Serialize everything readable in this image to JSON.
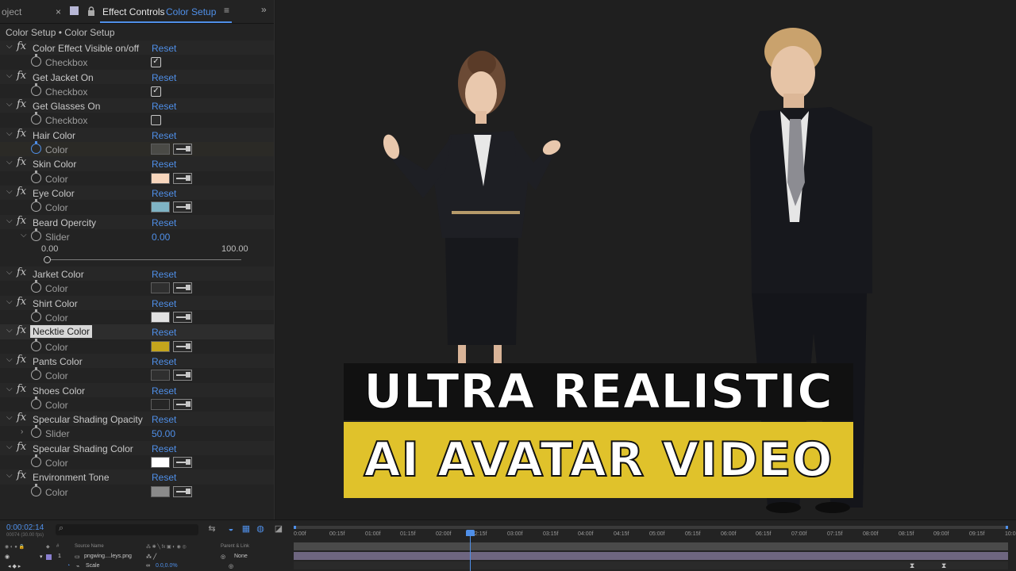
{
  "tabs": {
    "project_label": "oject",
    "close_glyph": "×",
    "lock_glyph": "🔒",
    "effect_controls_label": "Effect Controls",
    "comp_name": "Color Setup",
    "menu_glyph": "≡",
    "more_glyph": "»"
  },
  "breadcrumb": "Color Setup • Color Setup",
  "effects": [
    {
      "name": "Color Effect Visible on/off",
      "reset": "Reset",
      "param": "Checkbox",
      "kind": "checkbox",
      "checked": true
    },
    {
      "name": "Get Jacket On",
      "reset": "Reset",
      "param": "Checkbox",
      "kind": "checkbox",
      "checked": true
    },
    {
      "name": "Get Glasses On",
      "reset": "Reset",
      "param": "Checkbox",
      "kind": "checkbox",
      "checked": false
    },
    {
      "name": "Hair Color",
      "reset": "Reset",
      "param": "Color",
      "kind": "color",
      "color": "#4a4a46"
    },
    {
      "name": "Skin Color",
      "reset": "Reset",
      "param": "Color",
      "kind": "color",
      "color": "#f7d6bd"
    },
    {
      "name": "Eye Color",
      "reset": "Reset",
      "param": "Color",
      "kind": "color",
      "color": "#7fb3c4"
    },
    {
      "name": "Beard Opercity",
      "reset": "Reset",
      "param": "Slider",
      "kind": "slider",
      "value": "0.00",
      "min": "0.00",
      "max": "100.00"
    },
    {
      "name": "Jarket Color",
      "reset": "Reset",
      "param": "Color",
      "kind": "color",
      "color": "#2f2f2f"
    },
    {
      "name": "Shirt Color",
      "reset": "Reset",
      "param": "Color",
      "kind": "color",
      "color": "#e2e2e2"
    },
    {
      "name": "Necktie Color",
      "reset": "Reset",
      "param": "Color",
      "kind": "color",
      "color": "#c5a51d"
    },
    {
      "name": "Pants Color",
      "reset": "Reset",
      "param": "Color",
      "kind": "color",
      "color": "#2f2f2f"
    },
    {
      "name": "Shoes Color",
      "reset": "Reset",
      "param": "Color",
      "kind": "color",
      "color": "#262626"
    },
    {
      "name": "Specular Shading Opacity",
      "reset": "Reset",
      "param": "Slider",
      "kind": "value",
      "value": "50.00"
    },
    {
      "name": "Specular Shading Color",
      "reset": "Reset",
      "param": "Color",
      "kind": "color",
      "color": "#ffffff"
    },
    {
      "name": "Environment Tone",
      "reset": "Reset",
      "param": "Color",
      "kind": "color",
      "color": "#8a8a8a"
    }
  ],
  "headline": {
    "line1": "ULTRA REALISTIC",
    "line2": "AI AVATAR VIDEO",
    "accent": "#e0c22b"
  },
  "timeline": {
    "timecode": "0:00:02:14",
    "timecode_sub": "00074 (30.00 fps)",
    "ruler_ticks": [
      "0:00f",
      "00:15f",
      "01:00f",
      "01:15f",
      "02:00f",
      "02:15f",
      "03:00f",
      "03:15f",
      "04:00f",
      "04:15f",
      "05:00f",
      "05:15f",
      "06:00f",
      "06:15f",
      "07:00f",
      "07:15f",
      "08:00f",
      "08:15f",
      "09:00f",
      "09:15f",
      "10:0"
    ],
    "columns": {
      "source_name": "Source Name",
      "parent": "Parent & Link"
    },
    "layer": {
      "index": "1",
      "name": "pngwing....leys.png",
      "parent": "None"
    },
    "scale": {
      "label": "Scale",
      "value": "0.0,0.0%"
    }
  }
}
